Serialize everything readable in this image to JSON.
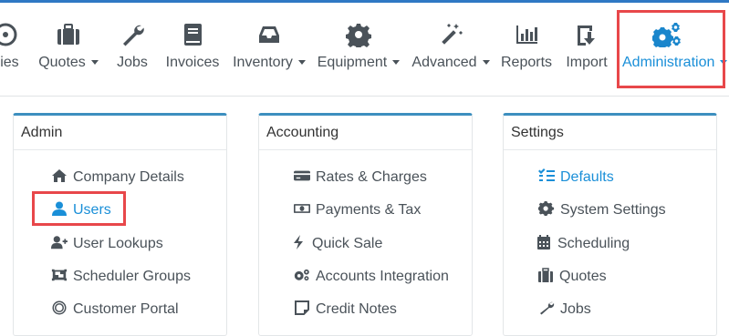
{
  "nav": {
    "items": [
      {
        "label": "iries",
        "icon": "circle-icon",
        "caret": false
      },
      {
        "label": "Quotes",
        "icon": "briefcase-icon",
        "caret": true
      },
      {
        "label": "Jobs",
        "icon": "wrench-icon",
        "caret": false
      },
      {
        "label": "Invoices",
        "icon": "book-icon",
        "caret": false
      },
      {
        "label": "Inventory",
        "icon": "inbox-icon",
        "caret": true
      },
      {
        "label": "Equipment",
        "icon": "gear-icon",
        "caret": true
      },
      {
        "label": "Advanced",
        "icon": "magic-wand-icon",
        "caret": true
      },
      {
        "label": "Reports",
        "icon": "bar-chart-icon",
        "caret": false
      },
      {
        "label": "Import",
        "icon": "import-icon",
        "caret": false
      },
      {
        "label": "Administration",
        "icon": "cogs-icon",
        "caret": true,
        "active": true
      }
    ]
  },
  "panels": [
    {
      "title": "Admin",
      "items": [
        {
          "label": "Company Details",
          "icon": "home-icon"
        },
        {
          "label": "Users",
          "icon": "user-icon",
          "highlighted": true
        },
        {
          "label": "User Lookups",
          "icon": "user-plus-icon"
        },
        {
          "label": "Scheduler Groups",
          "icon": "object-group-icon"
        },
        {
          "label": "Customer Portal",
          "icon": "life-ring-icon"
        }
      ]
    },
    {
      "title": "Accounting",
      "items": [
        {
          "label": "Rates & Charges",
          "icon": "credit-card-icon"
        },
        {
          "label": "Payments & Tax",
          "icon": "money-icon"
        },
        {
          "label": "Quick Sale",
          "icon": "bolt-icon"
        },
        {
          "label": "Accounts Integration",
          "icon": "cogs-icon"
        },
        {
          "label": "Credit Notes",
          "icon": "sticky-note-icon"
        }
      ]
    },
    {
      "title": "Settings",
      "items": [
        {
          "label": "Defaults",
          "icon": "list-check-icon",
          "active": true
        },
        {
          "label": "System Settings",
          "icon": "gear-icon"
        },
        {
          "label": "Scheduling",
          "icon": "calendar-icon"
        },
        {
          "label": "Quotes",
          "icon": "briefcase-icon"
        },
        {
          "label": "Jobs",
          "icon": "wrench-icon"
        }
      ]
    }
  ],
  "colors": {
    "accent": "#1a8fd8",
    "highlight_box": "#e8474a",
    "panel_top": "#3d8fbf",
    "text": "#4a5259"
  }
}
